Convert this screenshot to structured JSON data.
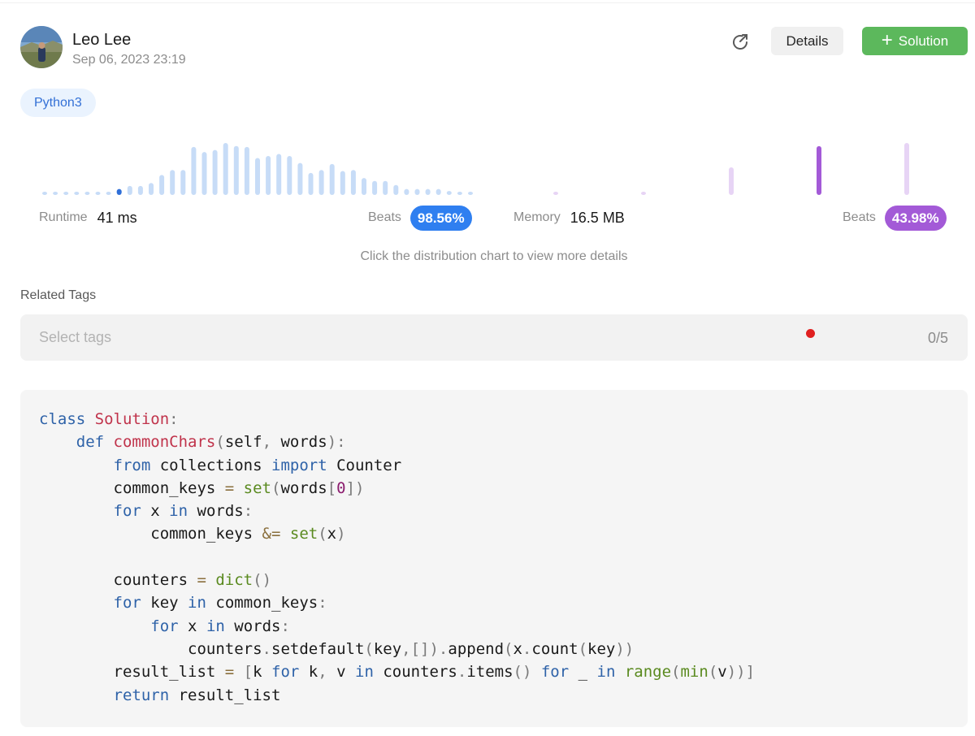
{
  "author": {
    "name": "Leo Lee",
    "date": "Sep 06, 2023 23:19"
  },
  "actions": {
    "details_label": "Details",
    "solution_label": "Solution",
    "share_icon": "share-icon",
    "plus_icon": "plus-icon"
  },
  "language_tag": "Python3",
  "runtime": {
    "label": "Runtime",
    "value": "41 ms",
    "beats_label": "Beats",
    "beats_value": "98.56%"
  },
  "memory": {
    "label": "Memory",
    "value": "16.5 MB",
    "beats_label": "Beats",
    "beats_value": "43.98%"
  },
  "hint": "Click the distribution chart to view more details",
  "related_tags": {
    "title": "Related Tags",
    "placeholder": "Select tags",
    "count": "0/5"
  },
  "colors": {
    "accent_blue": "#2f7ff0",
    "accent_purple": "#a35ad7",
    "solution_green": "#5cb85c",
    "bar_light_blue": "#c7dcf7",
    "bar_dark_blue": "#2f6fd8",
    "bar_light_purple": "#e7d4f5",
    "bar_dark_purple": "#a35ad7"
  },
  "chart_data": [
    {
      "type": "bar",
      "name": "runtime-distribution",
      "values": [
        0.2,
        0.2,
        0.2,
        0.2,
        0.2,
        0.2,
        0.2,
        0.6,
        0.9,
        0.9,
        1.2,
        2.0,
        2.5,
        2.5,
        4.8,
        4.3,
        4.5,
        5.2,
        4.9,
        4.8,
        3.7,
        3.9,
        4.1,
        3.9,
        3.2,
        2.2,
        2.5,
        3.1,
        2.4,
        2.5,
        1.7,
        1.4,
        1.4,
        1.0,
        0.6,
        0.6,
        0.6,
        0.6,
        0.4,
        0.3,
        0.3,
        0.3,
        0.3
      ],
      "highlight_index": 7
    },
    {
      "type": "bar",
      "name": "memory-distribution",
      "values": [
        0.2,
        0.2,
        2.6,
        4.6,
        4.9
      ],
      "highlight_index": 3
    }
  ],
  "code": {
    "language": "python",
    "lines": [
      [
        [
          "kw",
          "class "
        ],
        [
          "cls",
          "Solution"
        ],
        [
          "p",
          ":"
        ]
      ],
      [
        [
          "id",
          "    "
        ],
        [
          "kw",
          "def "
        ],
        [
          "fn",
          "commonChars"
        ],
        [
          "p",
          "("
        ],
        [
          "id",
          "self"
        ],
        [
          "p",
          ", "
        ],
        [
          "id",
          "words"
        ],
        [
          "p",
          "):"
        ]
      ],
      [
        [
          "id",
          "        "
        ],
        [
          "kw",
          "from "
        ],
        [
          "id",
          "collections "
        ],
        [
          "kw",
          "import "
        ],
        [
          "id",
          "Counter"
        ]
      ],
      [
        [
          "id",
          "        common_keys "
        ],
        [
          "op",
          "= "
        ],
        [
          "bi",
          "set"
        ],
        [
          "p",
          "("
        ],
        [
          "id",
          "words"
        ],
        [
          "p",
          "["
        ],
        [
          "num",
          "0"
        ],
        [
          "p",
          "])"
        ]
      ],
      [
        [
          "id",
          "        "
        ],
        [
          "kw",
          "for "
        ],
        [
          "id",
          "x "
        ],
        [
          "kw",
          "in "
        ],
        [
          "id",
          "words"
        ],
        [
          "p",
          ":"
        ]
      ],
      [
        [
          "id",
          "            common_keys "
        ],
        [
          "op",
          "&= "
        ],
        [
          "bi",
          "set"
        ],
        [
          "p",
          "("
        ],
        [
          "id",
          "x"
        ],
        [
          "p",
          ")"
        ]
      ],
      [],
      [
        [
          "id",
          "        counters "
        ],
        [
          "op",
          "= "
        ],
        [
          "bi",
          "dict"
        ],
        [
          "p",
          "()"
        ]
      ],
      [
        [
          "id",
          "        "
        ],
        [
          "kw",
          "for "
        ],
        [
          "id",
          "key "
        ],
        [
          "kw",
          "in "
        ],
        [
          "id",
          "common_keys"
        ],
        [
          "p",
          ":"
        ]
      ],
      [
        [
          "id",
          "            "
        ],
        [
          "kw",
          "for "
        ],
        [
          "id",
          "x "
        ],
        [
          "kw",
          "in "
        ],
        [
          "id",
          "words"
        ],
        [
          "p",
          ":"
        ]
      ],
      [
        [
          "id",
          "                counters"
        ],
        [
          "p",
          "."
        ],
        [
          "id",
          "setdefault"
        ],
        [
          "p",
          "("
        ],
        [
          "id",
          "key"
        ],
        [
          "p",
          ",[])."
        ],
        [
          "id",
          "append"
        ],
        [
          "p",
          "("
        ],
        [
          "id",
          "x"
        ],
        [
          "p",
          "."
        ],
        [
          "id",
          "count"
        ],
        [
          "p",
          "("
        ],
        [
          "id",
          "key"
        ],
        [
          "p",
          "))"
        ]
      ],
      [
        [
          "id",
          "        result_list "
        ],
        [
          "op",
          "= "
        ],
        [
          "p",
          "["
        ],
        [
          "id",
          "k "
        ],
        [
          "kw",
          "for "
        ],
        [
          "id",
          "k"
        ],
        [
          "p",
          ", "
        ],
        [
          "id",
          "v "
        ],
        [
          "kw",
          "in "
        ],
        [
          "id",
          "counters"
        ],
        [
          "p",
          "."
        ],
        [
          "id",
          "items"
        ],
        [
          "p",
          "() "
        ],
        [
          "kw",
          "for "
        ],
        [
          "id",
          "_ "
        ],
        [
          "kw",
          "in "
        ],
        [
          "bi",
          "range"
        ],
        [
          "p",
          "("
        ],
        [
          "bi",
          "min"
        ],
        [
          "p",
          "("
        ],
        [
          "id",
          "v"
        ],
        [
          "p",
          "))]"
        ]
      ],
      [
        [
          "id",
          "        "
        ],
        [
          "kw",
          "return "
        ],
        [
          "id",
          "result_list"
        ]
      ]
    ]
  }
}
